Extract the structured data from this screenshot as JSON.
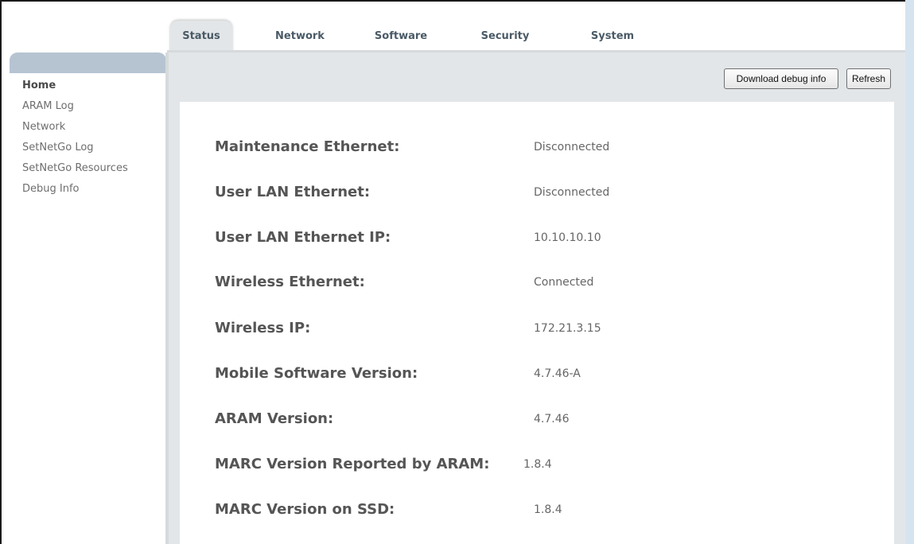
{
  "tabs": [
    {
      "label": "Status",
      "active": true
    },
    {
      "label": "Network",
      "active": false
    },
    {
      "label": "Software",
      "active": false
    },
    {
      "label": "Security",
      "active": false
    },
    {
      "label": "System",
      "active": false
    }
  ],
  "sidebar": {
    "items": [
      {
        "label": "Home",
        "active": true
      },
      {
        "label": "ARAM Log",
        "active": false
      },
      {
        "label": "Network",
        "active": false
      },
      {
        "label": "SetNetGo Log",
        "active": false
      },
      {
        "label": "SetNetGo Resources",
        "active": false
      },
      {
        "label": "Debug Info",
        "active": false
      }
    ]
  },
  "toolbar": {
    "download_label": "Download debug info",
    "refresh_label": "Refresh"
  },
  "status": {
    "rows": [
      {
        "label": "Maintenance Ethernet:",
        "value": "Disconnected"
      },
      {
        "label": "User LAN Ethernet:",
        "value": "Disconnected"
      },
      {
        "label": "User LAN Ethernet IP:",
        "value": "10.10.10.10"
      },
      {
        "label": "Wireless Ethernet:",
        "value": "Connected"
      },
      {
        "label": "Wireless IP:",
        "value": "172.21.3.15"
      },
      {
        "label": "Mobile Software Version:",
        "value": "4.7.46-A"
      },
      {
        "label": "ARAM Version:",
        "value": "4.7.46"
      },
      {
        "label": "MARC Version Reported by ARAM:",
        "value": "1.8.4"
      },
      {
        "label": "MARC Version on SSD:",
        "value": "1.8.4"
      }
    ]
  },
  "colors": {
    "tab_text": "#4a5a66",
    "sidebar_header": "#b6c4d2",
    "panel_bg": "#e3e6e8",
    "right_strip": "#d6e4ef"
  }
}
